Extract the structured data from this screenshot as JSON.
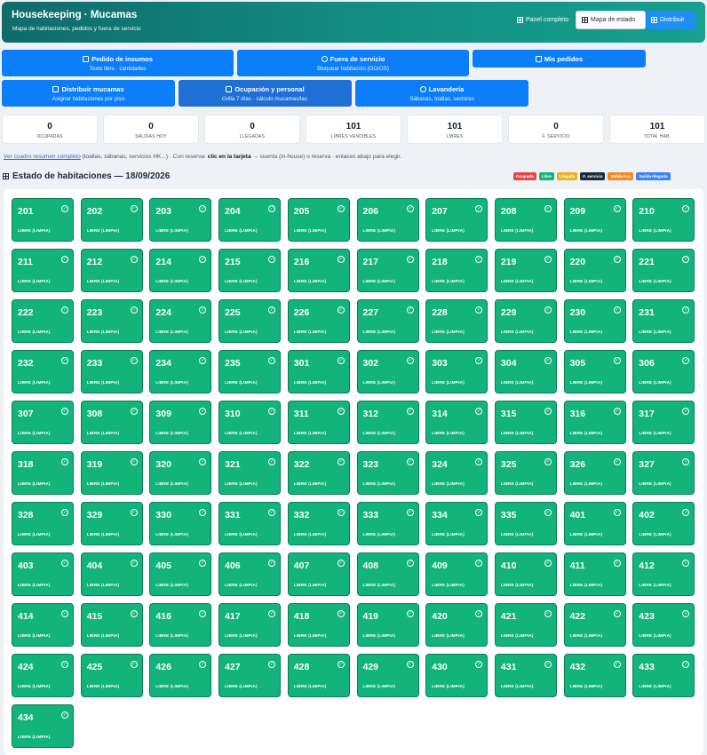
{
  "header": {
    "title": "Housekeeping · Mucamas",
    "subtitle": "Mapa de habitaciones, pedidos y fuera de servicio",
    "panel_label": "Panel completo",
    "mapa_label": "Mapa de estado",
    "distribuir_label": "Distribuir"
  },
  "actions": {
    "pedido": {
      "title": "Pedido de insumos",
      "sub": "Texto libre · cantidades"
    },
    "fuera": {
      "title": "Fuera de servicio",
      "sub": "Bloquear habitación (OO/OS)"
    },
    "mis": {
      "title": "Mis pedidos",
      "sub": ""
    },
    "distribuir": {
      "title": "Distribuir mucamas",
      "sub": "Asignar habitaciones por piso"
    },
    "ocupacion": {
      "title": "Ocupación y personal",
      "sub": "Grilla 7 días · cálculo mucamas/lav."
    },
    "lavanderia": {
      "title": "Lavandería",
      "sub": "Sábanas, toallas, sectores"
    }
  },
  "stats": [
    {
      "value": "0",
      "label": "OCUPADAS"
    },
    {
      "value": "0",
      "label": "SALIDAS HOY"
    },
    {
      "value": "0",
      "label": "LLEGADAS"
    },
    {
      "value": "101",
      "label": "LIBRES VENDIBLES"
    },
    {
      "value": "101",
      "label": "LIBRES"
    },
    {
      "value": "0",
      "label": "F. SERVICIO"
    },
    {
      "value": "101",
      "label": "TOTAL HAB."
    }
  ],
  "note": {
    "link": "Ver cuadro resumen completo",
    "text1": " (toallas, sábanas, servicios HK...) · Con reserva: ",
    "bold": "clic en la tarjeta",
    "text2": " → cuenta (in-house) o reserva · enlaces abajo para elegir."
  },
  "section_title": "Estado de habitaciones — 18/09/2026",
  "legend": [
    {
      "label": "Ocupada",
      "color": "#e04848"
    },
    {
      "label": "Libre",
      "color": "#13b47b"
    },
    {
      "label": "Llegada",
      "color": "#e9b422"
    },
    {
      "label": "F. servicio",
      "color": "#1f2937"
    },
    {
      "label": "Salida hoy",
      "color": "#f08a24"
    },
    {
      "label": "Salida+llegada",
      "color": "#3b82f6"
    }
  ],
  "room_status": "LIBRE (LIMPIA)",
  "rooms": [
    "201",
    "202",
    "203",
    "204",
    "205",
    "206",
    "207",
    "208",
    "209",
    "210",
    "211",
    "212",
    "214",
    "215",
    "216",
    "217",
    "218",
    "219",
    "220",
    "221",
    "222",
    "223",
    "224",
    "225",
    "226",
    "227",
    "228",
    "229",
    "230",
    "231",
    "232",
    "233",
    "234",
    "235",
    "301",
    "302",
    "303",
    "304",
    "305",
    "306",
    "307",
    "308",
    "309",
    "310",
    "311",
    "312",
    "314",
    "315",
    "316",
    "317",
    "318",
    "319",
    "320",
    "321",
    "322",
    "323",
    "324",
    "325",
    "326",
    "327",
    "328",
    "329",
    "330",
    "331",
    "332",
    "333",
    "334",
    "335",
    "401",
    "402",
    "403",
    "404",
    "405",
    "406",
    "407",
    "408",
    "409",
    "410",
    "411",
    "412",
    "414",
    "415",
    "416",
    "417",
    "418",
    "419",
    "420",
    "421",
    "422",
    "423",
    "424",
    "425",
    "426",
    "427",
    "428",
    "429",
    "430",
    "431",
    "432",
    "433",
    "434"
  ]
}
